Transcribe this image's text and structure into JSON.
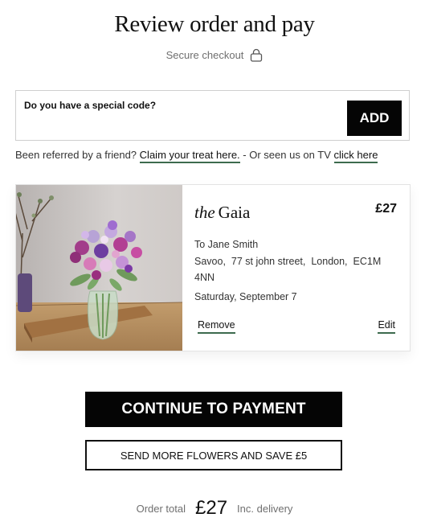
{
  "header": {
    "title": "Review order and pay",
    "secure_text": "Secure checkout",
    "secure_icon": "lock-icon"
  },
  "promo": {
    "label": "Do you have a special code?",
    "add_label": "ADD"
  },
  "referral": {
    "prefix": "Been referred by a friend?",
    "claim_link": "Claim your treat here.",
    "middle": "- Or seen us on TV",
    "tv_link": "click here"
  },
  "product": {
    "name_italic": "the",
    "name": "Gaia",
    "price": "£27",
    "recipient": "To  Jane Smith",
    "address": [
      "Savoo,",
      "77 st john street,",
      "London,",
      "EC1M 4NN"
    ],
    "delivery_date": "Saturday, September 7",
    "remove_label": "Remove",
    "edit_label": "Edit",
    "image": "bouquet of purple and pink stock flowers in glass vase"
  },
  "actions": {
    "continue_label": "CONTINUE TO PAYMENT",
    "send_more_label": "SEND MORE FLOWERS AND SAVE £5"
  },
  "summary": {
    "order_total_label": "Order total",
    "order_total": "£27",
    "delivery_note": "Inc. delivery"
  },
  "colors": {
    "primary": "#050505",
    "link_underline": "#3d6b4e",
    "muted_text": "#6f6f6f"
  }
}
